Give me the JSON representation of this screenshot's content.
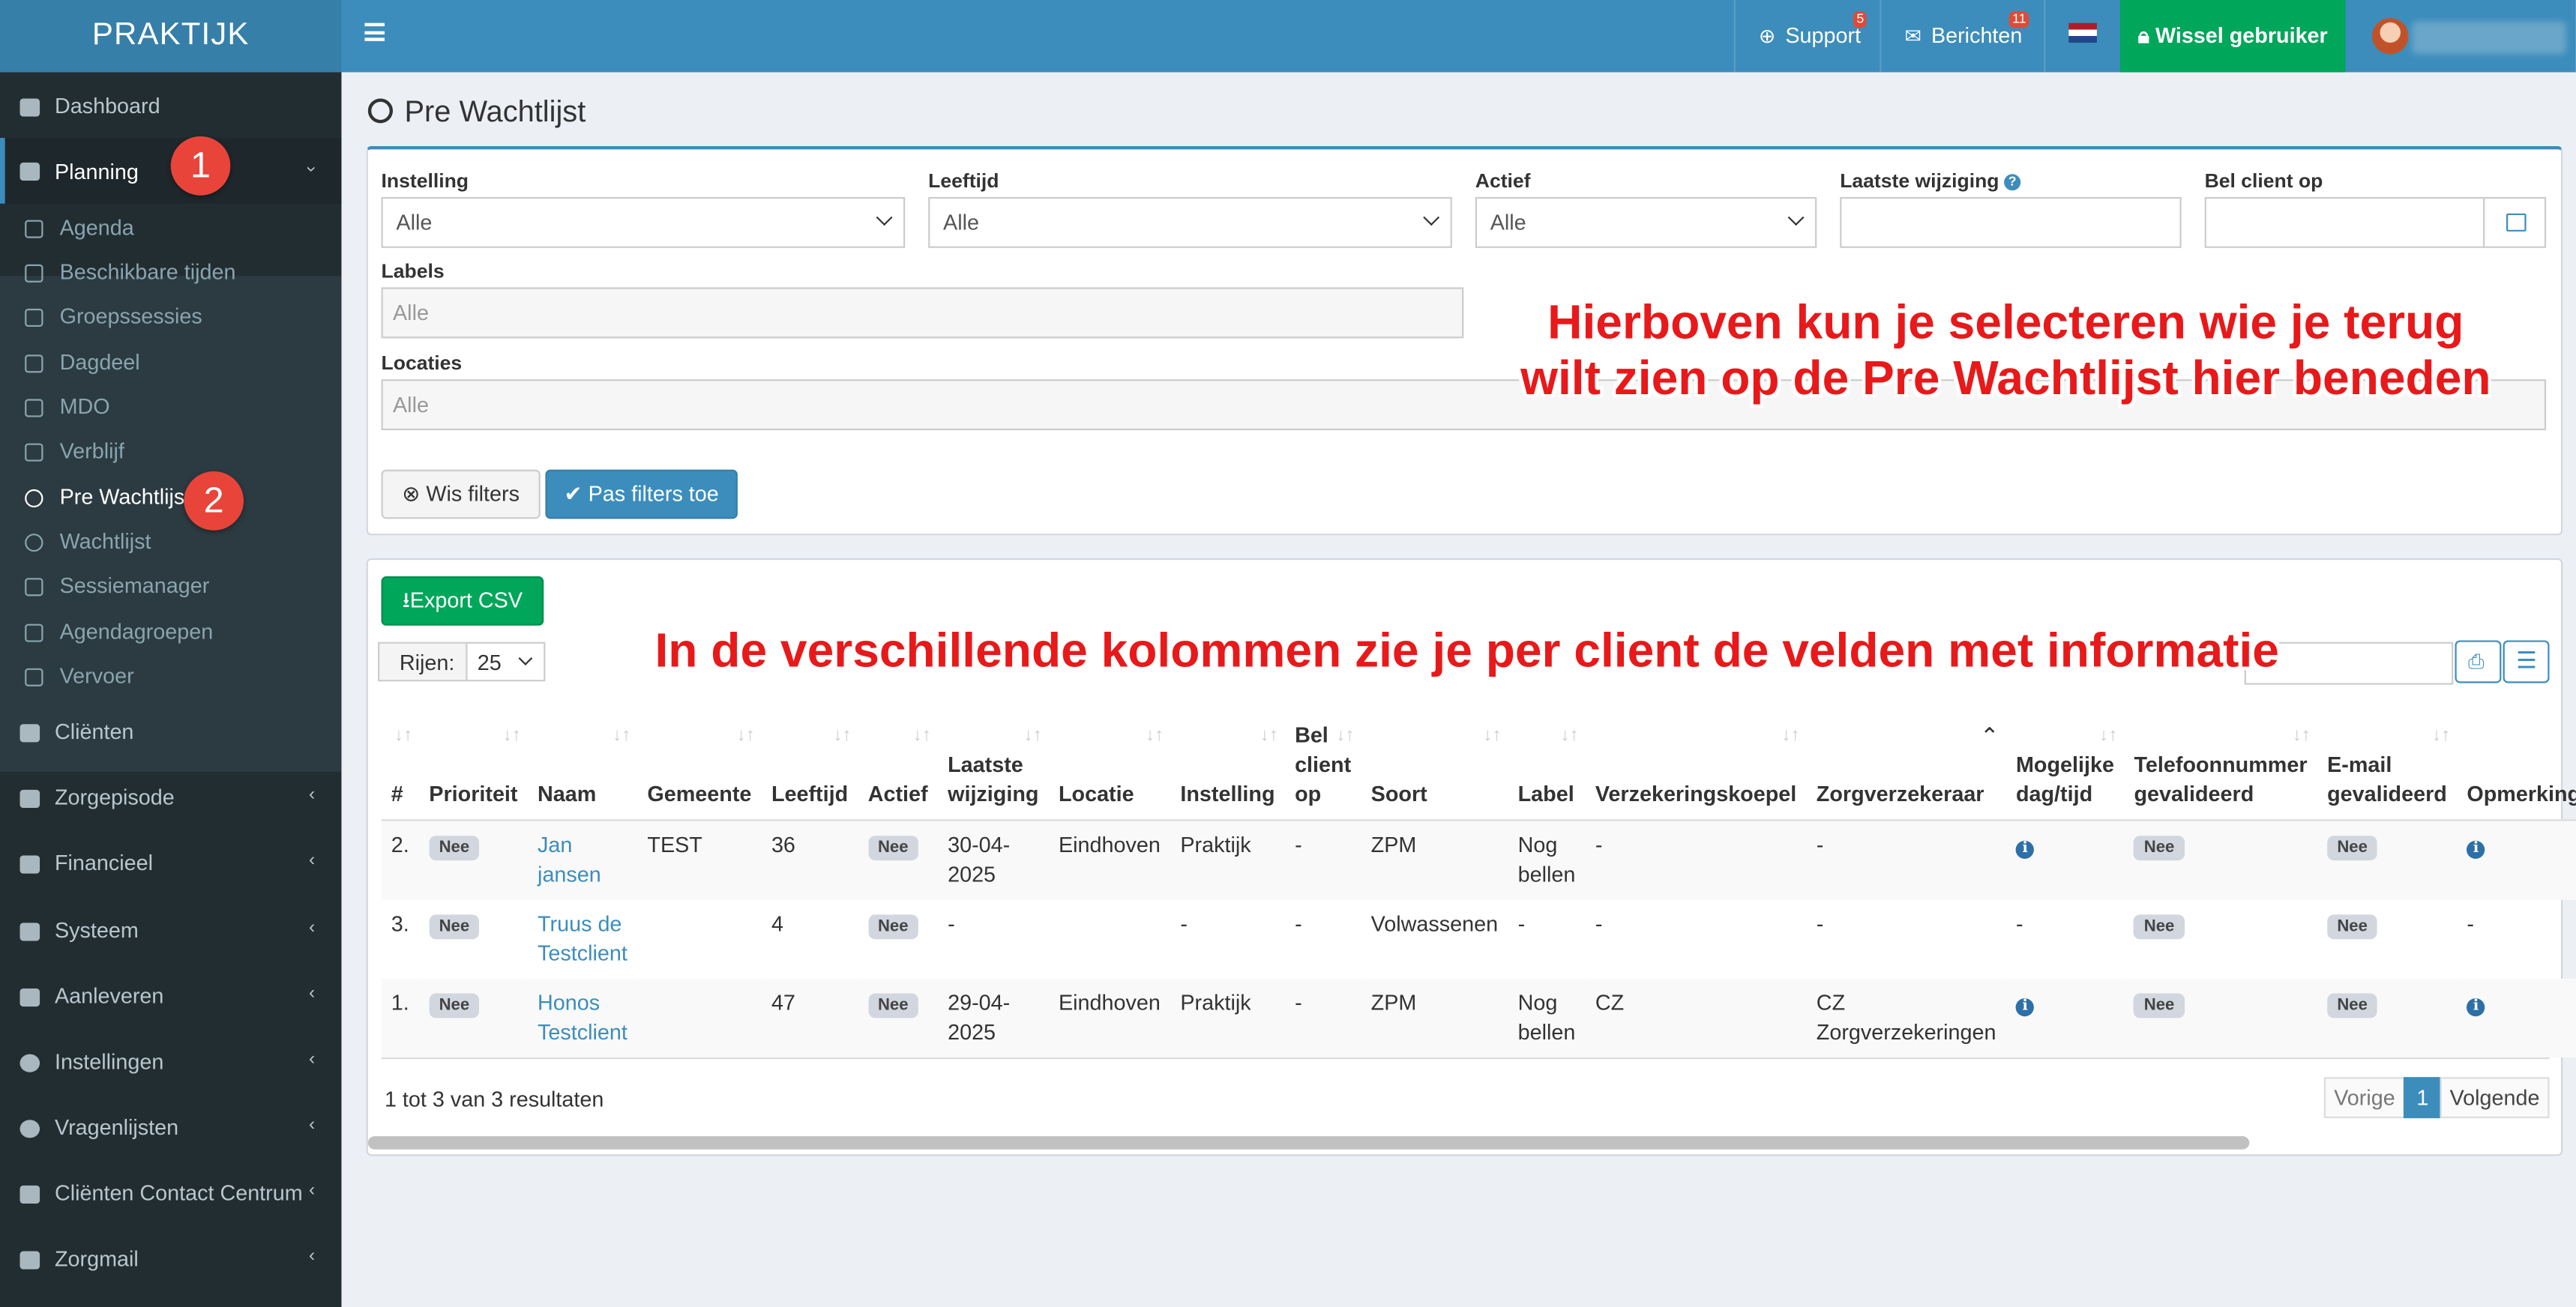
{
  "app": {
    "logo": "PRAKTIJK"
  },
  "topnav": {
    "support": "Support",
    "support_badge": "5",
    "berichten": "Berichten",
    "berichten_badge": "11",
    "wissel": "Wissel gebruiker"
  },
  "sidebar": {
    "items": [
      {
        "label": "Dashboard"
      },
      {
        "label": "Planning"
      },
      {
        "label": "Cliënten"
      },
      {
        "label": "Zorgepisode"
      },
      {
        "label": "Financieel"
      },
      {
        "label": "Systeem"
      },
      {
        "label": "Aanleveren"
      },
      {
        "label": "Instellingen"
      },
      {
        "label": "Vragenlijsten"
      },
      {
        "label": "Cliënten Contact Centrum"
      },
      {
        "label": "Zorgmail"
      }
    ],
    "sub": [
      {
        "label": "Agenda"
      },
      {
        "label": "Beschikbare tijden"
      },
      {
        "label": "Groepssessies"
      },
      {
        "label": "Dagdeel"
      },
      {
        "label": "MDO"
      },
      {
        "label": "Verblijf"
      },
      {
        "label": "Pre Wachtlijst"
      },
      {
        "label": "Wachtlijst"
      },
      {
        "label": "Sessiemanager"
      },
      {
        "label": "Agendagroepen"
      },
      {
        "label": "Vervoer"
      }
    ]
  },
  "annotations": {
    "step1": "1",
    "step2": "2",
    "text1_l1": "Hierboven kun je selecteren wie je terug",
    "text1_l2": "wilt zien op de Pre Wachtlijst hier beneden",
    "text2": "In de verschillende kolommen zie je per client de velden met informatie"
  },
  "page": {
    "title": "Pre Wachtlijst"
  },
  "filters": {
    "instelling_label": "Instelling",
    "instelling_value": "Alle",
    "leeftijd_label": "Leeftijd",
    "leeftijd_value": "Alle",
    "actief_label": "Actief",
    "actief_value": "Alle",
    "laatste_label": "Laatste wijziging",
    "bel_label": "Bel client op",
    "labels_label": "Labels",
    "labels_placeholder": "Alle",
    "locaties_label": "Locaties",
    "locaties_placeholder": "Alle",
    "wis": "Wis filters",
    "pas": "Pas filters toe"
  },
  "table_tools": {
    "export": "Export CSV",
    "rijen": "Rijen:",
    "rijen_value": "25"
  },
  "columns": [
    "#",
    "Prioriteit",
    "Naam",
    "Gemeente",
    "Leeftijd",
    "Actief",
    "Laatste wijziging",
    "Locatie",
    "Instelling",
    "Bel client op",
    "Soort",
    "Label",
    "Verzekeringskoepel",
    "Zorgverzekeraar",
    "Mogelijke dag/tijd",
    "Telefoonnummer gevalideerd",
    "E-mail gevalideerd",
    "Opmerkingen"
  ],
  "rows": [
    {
      "nr": "2.",
      "prioriteit": "Nee",
      "naam": "Jan jansen",
      "gemeente": "TEST",
      "leeftijd": "36",
      "actief": "Nee",
      "laatste": "30-04-2025",
      "locatie": "Eindhoven",
      "instelling": "Praktijk",
      "bel": "-",
      "soort": "ZPM",
      "label": "Nog bellen",
      "koepel": "-",
      "verzekeraar": "-",
      "dagtijd": "i",
      "tel": "Nee",
      "email": "Nee",
      "opm": "i"
    },
    {
      "nr": "3.",
      "prioriteit": "Nee",
      "naam": "Truus de Testclient",
      "gemeente": "",
      "leeftijd": "4",
      "actief": "Nee",
      "laatste": "-",
      "locatie": "",
      "instelling": "-",
      "bel": "-",
      "soort": "Volwassenen",
      "label": "-",
      "koepel": "-",
      "verzekeraar": "-",
      "dagtijd": "-",
      "tel": "Nee",
      "email": "Nee",
      "opm": "-"
    },
    {
      "nr": "1.",
      "prioriteit": "Nee",
      "naam": "Honos Testclient",
      "gemeente": "",
      "leeftijd": "47",
      "actief": "Nee",
      "laatste": "29-04-2025",
      "locatie": "Eindhoven",
      "instelling": "Praktijk",
      "bel": "-",
      "soort": "ZPM",
      "label": "Nog bellen",
      "koepel": "CZ",
      "verzekeraar": "CZ Zorgverzekeringen",
      "dagtijd": "i",
      "tel": "Nee",
      "email": "Nee",
      "opm": "i"
    }
  ],
  "footer": {
    "results": "1 tot 3 van 3 resultaten",
    "vorige": "Vorige",
    "page": "1",
    "volgende": "Volgende"
  }
}
